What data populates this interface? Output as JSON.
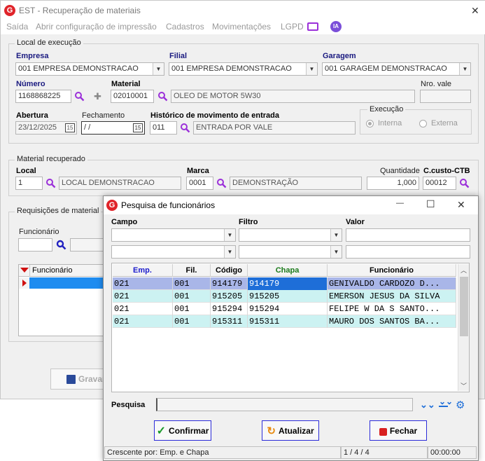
{
  "main_window": {
    "title": "EST - Recuperação de materiais",
    "close_glyph": "✕",
    "logo_text": "G"
  },
  "menu": {
    "items": [
      "Saída",
      "Abrir configuração de impressão",
      "Cadastros",
      "Movimentações",
      "LGPD"
    ],
    "ia_label": "IA"
  },
  "local_execucao": {
    "title": "Local de execução",
    "empresa_label": "Empresa",
    "empresa_value": "001 EMPRESA DEMONSTRACAO",
    "filial_label": "Filial",
    "filial_value": "001 EMPRESA DEMONSTRACAO",
    "garagem_label": "Garagem",
    "garagem_value": "001 GARAGEM DEMONSTRACAO",
    "numero_label": "Número",
    "numero_value": "1168868225",
    "material_label": "Material",
    "material_code": "02010001",
    "material_desc": "OLEO DE MOTOR 5W30",
    "nro_vale_label": "Nro. vale",
    "nro_vale_value": "",
    "abertura_label": "Abertura",
    "abertura_value": "23/12/2025",
    "fechamento_label": "Fechamento",
    "fechamento_value": " / /",
    "historico_label": "Histórico de movimento de entrada",
    "historico_code": "011",
    "historico_desc": "ENTRADA POR VALE",
    "execucao_title": "Execução",
    "interna_label": "Interna",
    "externa_label": "Externa",
    "calendar_glyph": "15"
  },
  "material_recuperado": {
    "title": "Material recuperado",
    "local_label": "Local",
    "local_code": "1",
    "local_desc": "LOCAL DEMONSTRACAO",
    "marca_label": "Marca",
    "marca_code": "0001",
    "marca_desc": "DEMONSTRAÇÃO",
    "quantidade_label": "Quantidade",
    "quantidade_value": "1,000",
    "ccusto_label": "C.custo-CTB",
    "ccusto_value": "00012"
  },
  "requisicoes": {
    "title": "Requisições de material",
    "funcionario_label": "Funcionário",
    "grid_header": "Funcionário"
  },
  "gravar_label": "Gravar",
  "dialog": {
    "title": "Pesquisa de funcionários",
    "minimize_glyph": "—",
    "maximize_glyph": "☐",
    "close_glyph": "✕",
    "campo_label": "Campo",
    "filtro_label": "Filtro",
    "valor_label": "Valor",
    "columns": [
      "Emp.",
      "Fil.",
      "Código",
      "Chapa",
      "Funcionário"
    ],
    "column_colors": [
      "#1a1acc",
      "#000000",
      "#000000",
      "#1a7a1a",
      "#000000"
    ],
    "rows": [
      [
        "021",
        "001",
        "914179",
        "914179",
        "GENIVALDO CARDOZO D..."
      ],
      [
        "021",
        "001",
        "915205",
        "915205",
        "EMERSON JESUS DA SILVA"
      ],
      [
        "021",
        "001",
        "915294",
        "915294",
        "FELIPE W DA S SANTO..."
      ],
      [
        "021",
        "001",
        "915311",
        "915311",
        "MAURO DOS SANTOS BA..."
      ]
    ],
    "pesquisa_label": "Pesquisa",
    "confirmar_label": "Confirmar",
    "atualizar_label": "Atualizar",
    "fechar_label": "Fechar",
    "status_sort": "Crescente por: Emp. e Chapa",
    "status_count": "1 / 4 / 4",
    "status_time": "00:00:00"
  },
  "colors": {
    "selected_row": "#a9b6e8",
    "alt_row": "#ccf2f2",
    "accent_icon": "#9b30d9",
    "main_logo": "#e0242a"
  }
}
